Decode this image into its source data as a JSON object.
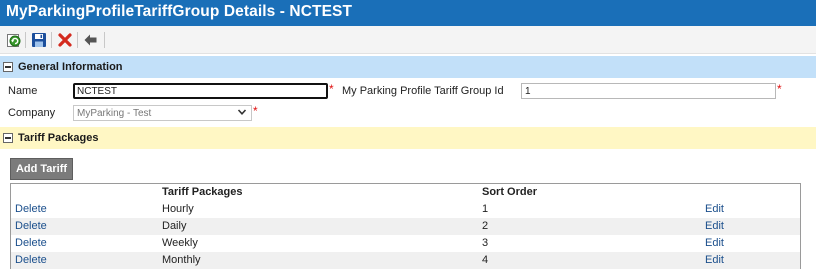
{
  "window": {
    "title": "MyParkingProfileTariffGroup Details - NCTEST"
  },
  "toolbar": {
    "buttons": [
      {
        "name": "refresh-icon",
        "color": "#3a9a2e"
      },
      {
        "name": "save-icon",
        "color": "#1c4f9c"
      },
      {
        "name": "delete-icon",
        "color": "#d42a1e"
      },
      {
        "name": "back-arrow-icon",
        "color": "#555555"
      }
    ]
  },
  "general": {
    "header": "General Information",
    "name_label": "Name",
    "name_value": "NCTEST",
    "company_label": "Company",
    "company_value": "MyParking - Test",
    "group_id_label": "My Parking Profile Tariff Group Id",
    "group_id_value": "1",
    "required_mark": "*"
  },
  "tariff": {
    "header": "Tariff Packages",
    "add_button": "Add Tariff",
    "columns": [
      "",
      "Tariff Packages",
      "Sort Order",
      ""
    ],
    "rows": [
      {
        "delete": "Delete",
        "package": "Hourly",
        "sort": "1",
        "edit": "Edit"
      },
      {
        "delete": "Delete",
        "package": "Daily",
        "sort": "2",
        "edit": "Edit"
      },
      {
        "delete": "Delete",
        "package": "Weekly",
        "sort": "3",
        "edit": "Edit"
      },
      {
        "delete": "Delete",
        "package": "Monthly",
        "sort": "4",
        "edit": "Edit"
      }
    ]
  },
  "colors": {
    "title_bar": "#1a6fb8",
    "general_header": "#c2e0f9",
    "tariff_header": "#fff7c4",
    "link": "#1b4f8c",
    "required": "#e01010"
  }
}
